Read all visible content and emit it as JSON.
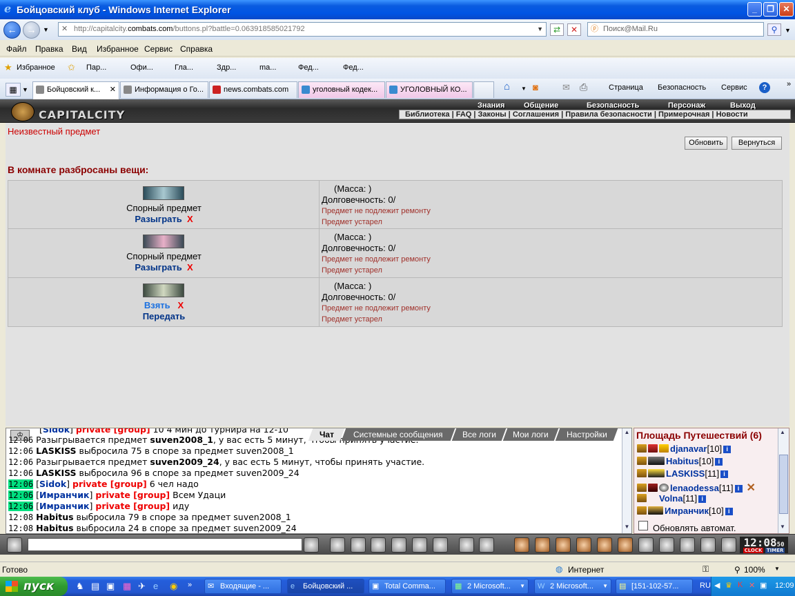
{
  "window": {
    "title": "Бойцовский клуб - Windows Internet Explorer"
  },
  "address": {
    "url_prefix": "http://capitalcity.",
    "url_domain": "combats.com",
    "url_rest": "/buttons.pl?battle=0.063918585021792"
  },
  "search": {
    "placeholder": "Поиск@Mail.Ru"
  },
  "menu": [
    "Файл",
    "Правка",
    "Вид",
    "Избранное",
    "Сервис",
    "Справка"
  ],
  "favorites": {
    "label": "Избранное",
    "items": [
      "Пар...",
      "Офи...",
      "Гла...",
      "Здр...",
      "ma...",
      "Фед...",
      "Фед..."
    ]
  },
  "tabs": [
    "Бойцовский к...",
    "Информация о Го...",
    "news.combats.com",
    "уголовный кодек...",
    "УГОЛОВНЫЙ КО..."
  ],
  "commandbar": [
    "Страница",
    "Безопасность",
    "Сервис"
  ],
  "game": {
    "logo": "CAPITALCITY",
    "topnav": [
      "Знания",
      "Общение",
      "Безопасность",
      "Персонаж",
      "Выход"
    ],
    "subnav": "Библиотека | FAQ | Законы | Соглашения | Правила безопасности | Примерочная | Новости"
  },
  "content": {
    "unknown_item": "Неизвестный предмет",
    "refresh_button": "Обновить",
    "back_button": "Вернуться",
    "room_title": "В комнате разбросаны вещи:",
    "items": [
      {
        "name": "Спорный предмет",
        "action": "Разыграть",
        "close": "X",
        "mass": "(Масса: )",
        "durability": "Долговечность: 0/",
        "warn1": "Предмет не подлежит ремонту",
        "warn2": "Предмет устарел"
      },
      {
        "name": "Спорный предмет",
        "action": "Разыграть",
        "close": "X",
        "mass": "(Масса: )",
        "durability": "Долговечность: 0/",
        "warn1": "Предмет не подлежит ремонту",
        "warn2": "Предмет устарел"
      },
      {
        "take": "Взять",
        "close": "X",
        "give": "Передать",
        "mass": "(Масса: )",
        "durability": "Долговечность: 0/",
        "warn1": "Предмет не подлежит ремонту",
        "warn2": "Предмет устарел"
      }
    ]
  },
  "chat": {
    "tabs": [
      "Чат",
      "Системные сообщения",
      "Все логи",
      "Мои логи",
      "Настройки"
    ],
    "lines": [
      {
        "time": "",
        "pre": "[",
        "nick": "Sidok",
        "post": "] ",
        "priv": "private [group]",
        "text": " 10 4 мин до турнира на 12-10"
      },
      {
        "time": "12:06",
        "text": "Разыгрывается предмет ",
        "bold": "suven2008_1",
        "tail": ", у вас есть 5 минут, чтобы принять участие."
      },
      {
        "time": "12:06",
        "nick": "LASKISS",
        "text": " выбросила 75 в споре за предмет suven2008_1"
      },
      {
        "time": "12:06",
        "text": "Разыгрывается предмет ",
        "bold": "suven2009_24",
        "tail": ", у вас есть 5 минут, чтобы принять участие."
      },
      {
        "time": "12:06",
        "nick": "LASKISS",
        "text": " выбросила 96 в споре за предмет suven2009_24"
      },
      {
        "time": "12:06",
        "pre": "[",
        "nick": "Sidok",
        "post": "] ",
        "priv": "private [group]",
        "text": " 6 чел надо"
      },
      {
        "time": "12:06",
        "pre": "[",
        "nick": "Имранчик",
        "post": "] ",
        "priv": "private [group]",
        "text": " Всем Удаци"
      },
      {
        "time": "12:06",
        "pre": "[",
        "nick": "Имранчик",
        "post": "] ",
        "priv": "private [group]",
        "text": " иду"
      },
      {
        "time": "12:08",
        "nick": "Habitus",
        "text": " выбросила 79 в споре за предмет suven2008_1"
      },
      {
        "time": "12:08",
        "nick": "Habitus",
        "text": " выбросила 24 в споре за предмет suven2009_24"
      }
    ]
  },
  "players": {
    "title": "Площадь Путешествий (6)",
    "list": [
      {
        "name": "djanavar",
        "level": "[10]"
      },
      {
        "name": "Habitus",
        "level": "[10]"
      },
      {
        "name": "LASKISS",
        "level": "[11]"
      },
      {
        "name": "lenaodessa",
        "level": "[11]"
      },
      {
        "name": "Volna",
        "level": "[11]"
      },
      {
        "name": "Имранчик",
        "level": "[10]"
      }
    ],
    "auto_refresh": "Обновлять автомат."
  },
  "clock": {
    "time": "12:08",
    "sec": "50",
    "clock_label": "CLOCK",
    "timer_label": "TIMER"
  },
  "status": {
    "left": "Готово",
    "zone": "Интернет",
    "zoom": "100%"
  },
  "taskbar": {
    "start": "пуск",
    "buttons": [
      "Входящие - ...",
      "Бойцовский ...",
      "Total Comma...",
      "2 Microsoft...",
      "2 Microsoft...",
      "[151-102-57..."
    ],
    "lang": "RU",
    "time": "12:09"
  }
}
